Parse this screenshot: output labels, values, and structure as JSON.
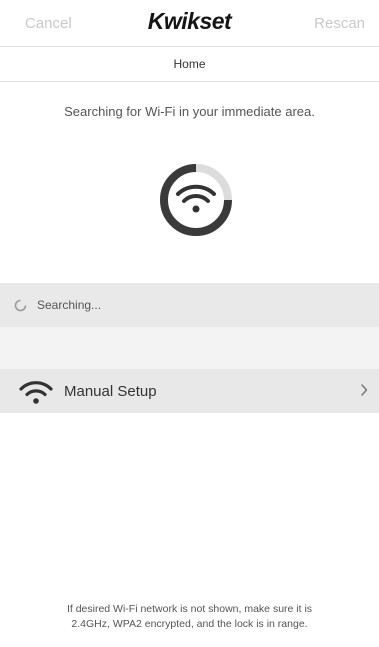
{
  "nav": {
    "cancel_label": "Cancel",
    "brand": "Kwikset",
    "rescan_label": "Rescan"
  },
  "header": {
    "title": "Home"
  },
  "main": {
    "intro": "Searching for Wi-Fi in your immediate area.",
    "status_icon": "wifi-search-icon",
    "searching_label": "Searching...",
    "manual_setup_label": "Manual Setup"
  },
  "footer": {
    "line1": "If desired Wi-Fi network is not shown, make sure it is",
    "line2": "2.4GHz, WPA2 encrypted, and the lock is in range."
  },
  "colors": {
    "muted_nav_text": "#c9c9c9",
    "brand_text": "#151515",
    "row_background": "#e8e8e8"
  }
}
